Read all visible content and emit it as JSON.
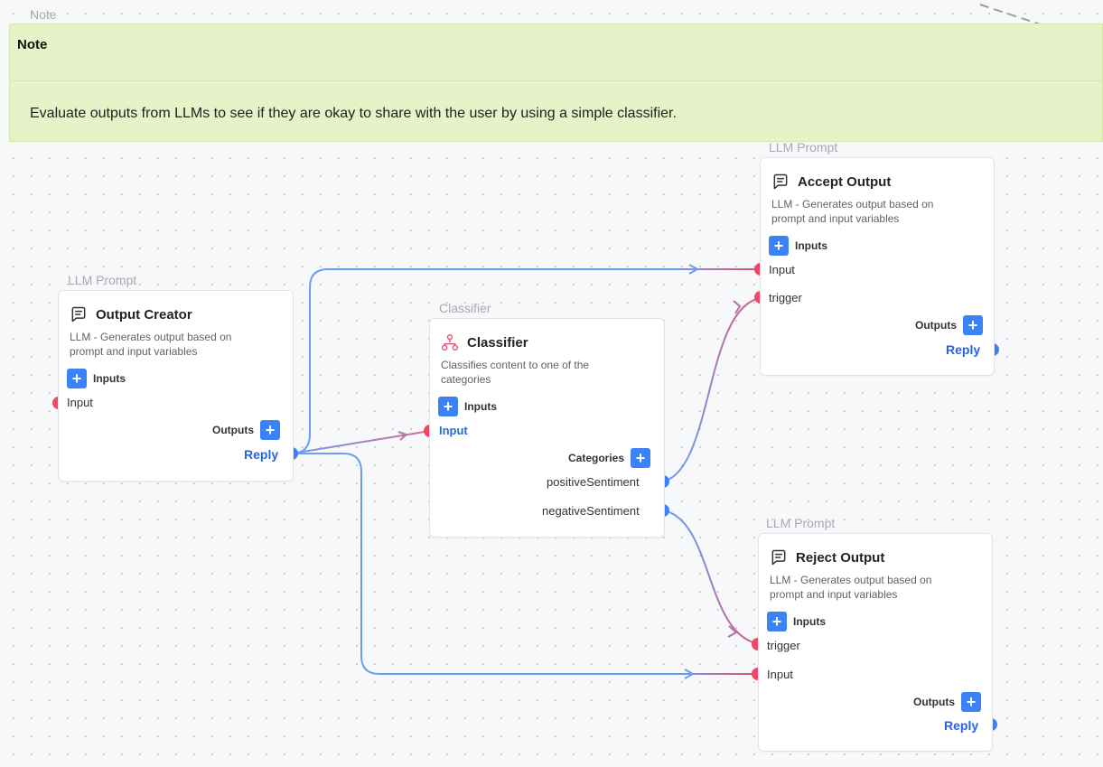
{
  "note": {
    "tag": "Note",
    "title": "Note",
    "text": "Evaluate outputs from LLMs to see if they are okay to share with the user by using a simple classifier."
  },
  "nodes": {
    "output_creator": {
      "tag": "LLM Prompt",
      "icon": "message-square-icon",
      "title": "Output Creator",
      "description": "LLM - Generates output based on prompt and input variables",
      "inputs_label": "Inputs",
      "inputs": [
        "Input"
      ],
      "outputs_label": "Outputs",
      "outputs": [
        "Reply"
      ]
    },
    "classifier": {
      "tag": "Classifier",
      "icon": "hierarchy-icon",
      "title": "Classifier",
      "description": "Classifies content to one of the categories",
      "inputs_label": "Inputs",
      "inputs": [
        "Input"
      ],
      "categories_label": "Categories",
      "categories": [
        "positiveSentiment",
        "negativeSentiment"
      ]
    },
    "accept_output": {
      "tag": "LLM Prompt",
      "icon": "message-square-icon",
      "title": "Accept Output",
      "description": "LLM - Generates output based on prompt and input variables",
      "inputs_label": "Inputs",
      "inputs": [
        "Input",
        "trigger"
      ],
      "outputs_label": "Outputs",
      "outputs": [
        "Reply"
      ]
    },
    "reject_output": {
      "tag": "LLM Prompt",
      "icon": "message-square-icon",
      "title": "Reject Output",
      "description": "LLM - Generates output based on prompt and input variables",
      "inputs_label": "Inputs",
      "inputs": [
        "trigger",
        "Input"
      ],
      "outputs_label": "Outputs",
      "outputs": [
        "Reply"
      ]
    }
  },
  "colors": {
    "output_port": "#3b82f6",
    "input_port": "#ef4866",
    "wire_blue": "#6b9ef0",
    "wire_red": "#ef4866",
    "accent": "#3b82f6",
    "note_bg": "#e6f2c8"
  }
}
